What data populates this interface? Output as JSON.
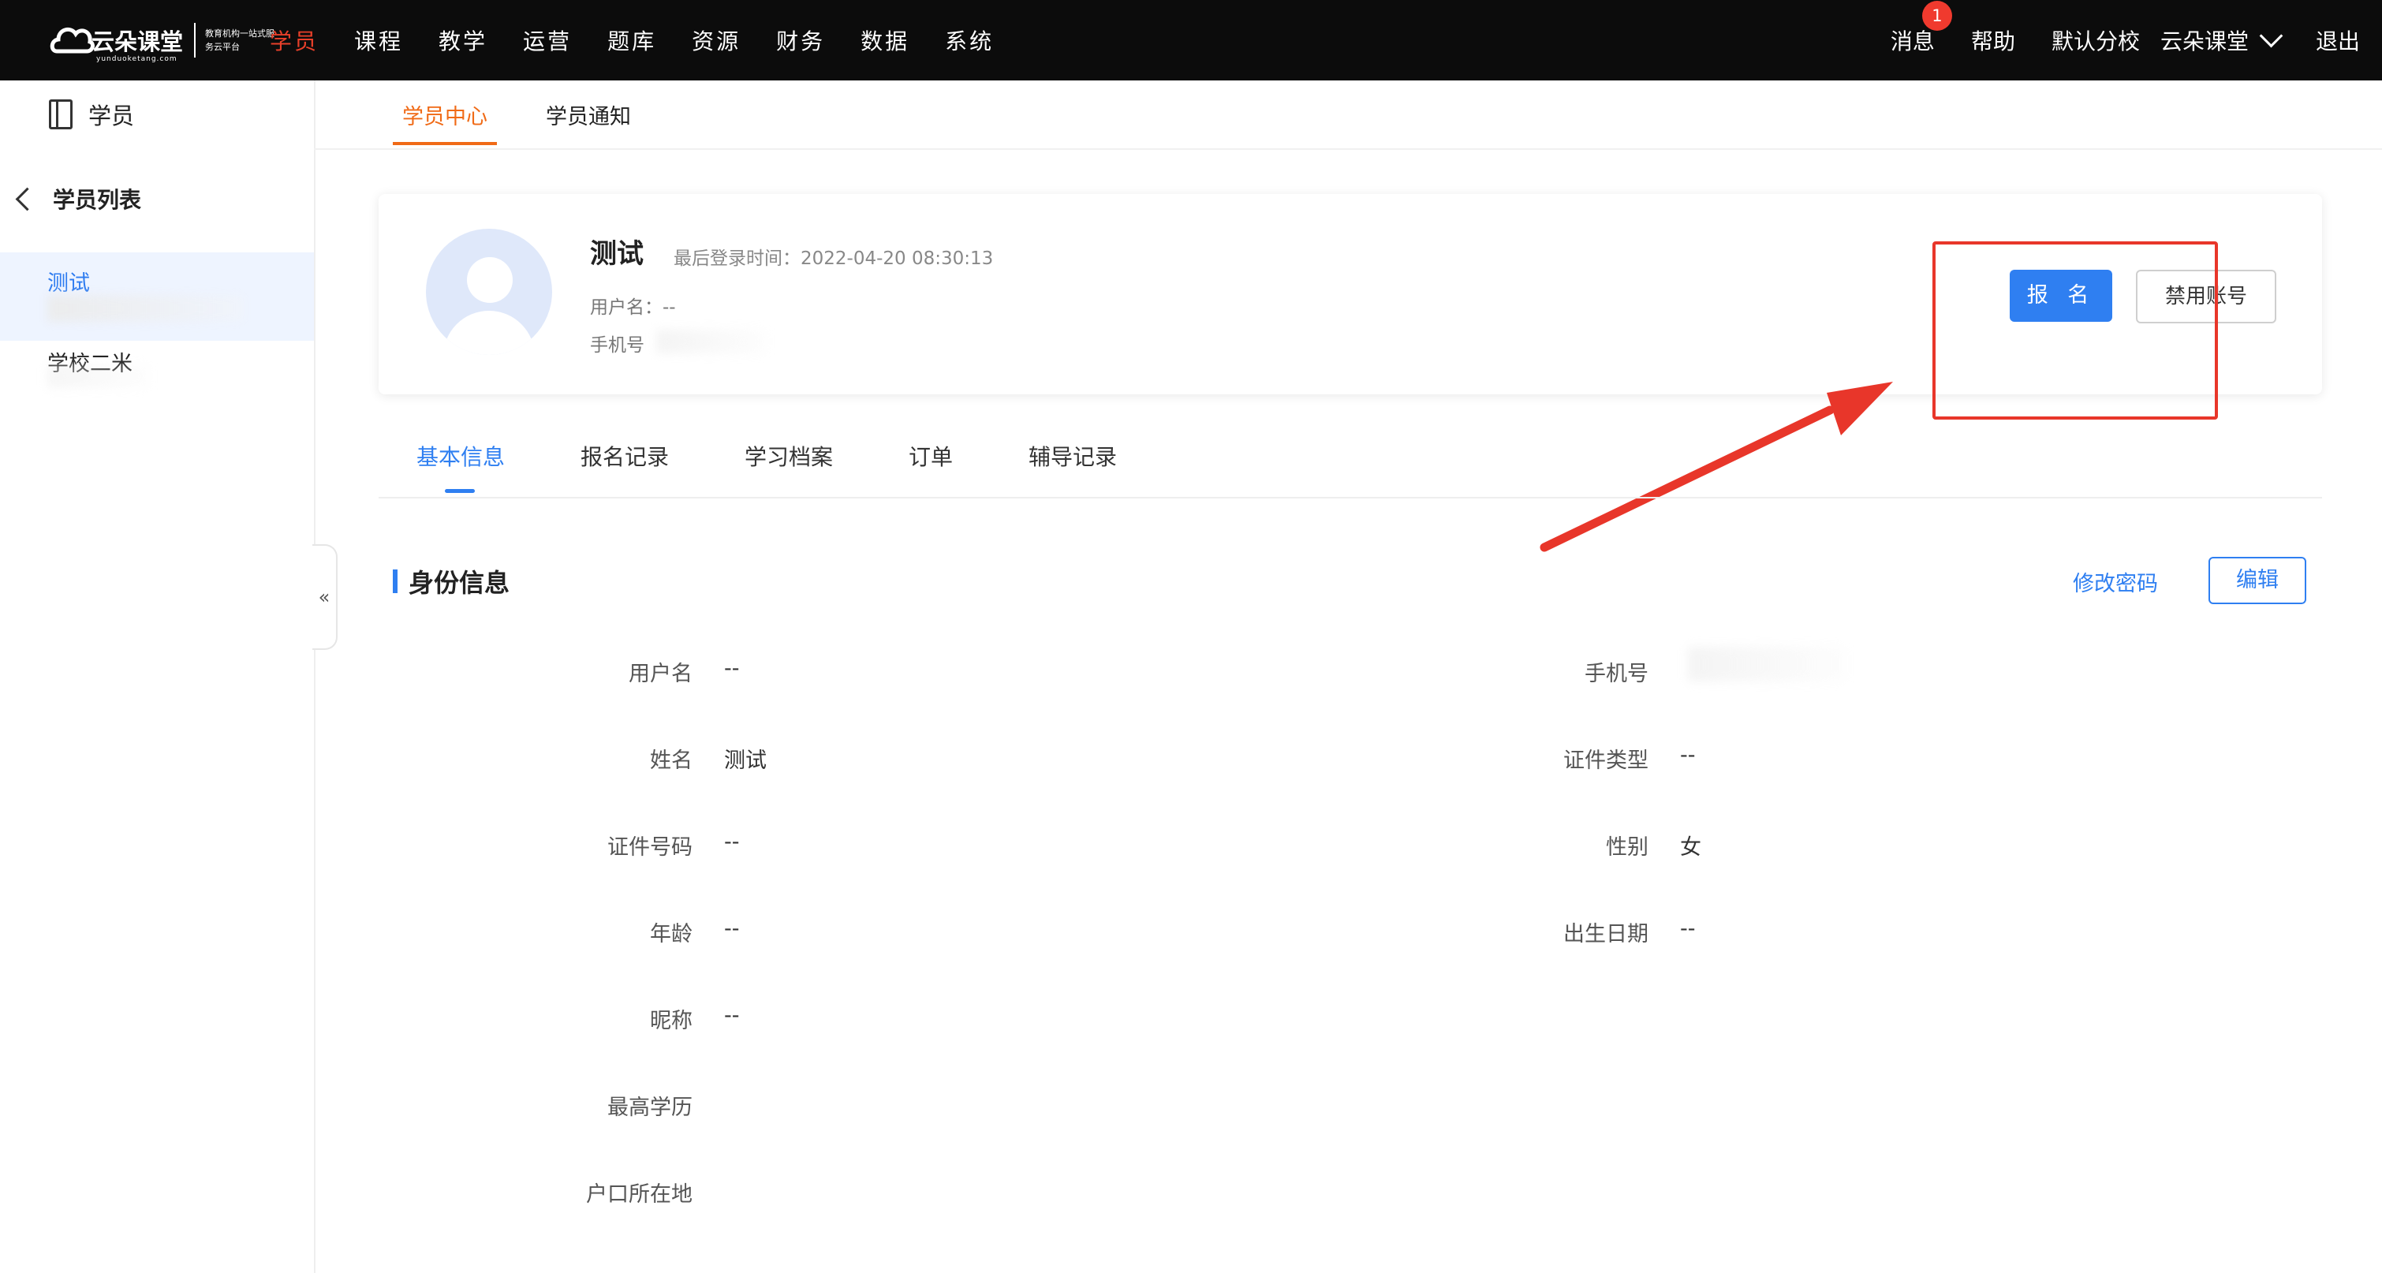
{
  "header": {
    "logo": {
      "name": "云朵课堂",
      "domain": "yunduoketang.com",
      "tagline": "教育机构一站式服务云平台"
    },
    "nav": [
      "学员",
      "课程",
      "教学",
      "运营",
      "题库",
      "资源",
      "财务",
      "数据",
      "系统"
    ],
    "active_nav": "学员",
    "right": {
      "messages": "消息",
      "message_count": "1",
      "help": "帮助",
      "school": "默认分校",
      "org": "云朵课堂",
      "logout": "退出"
    }
  },
  "sidebar": {
    "title": "学员",
    "back_label": "学员列表",
    "items": [
      "测试",
      "学校二米"
    ],
    "collapse_glyph": "«"
  },
  "subtabs": [
    "学员中心",
    "学员通知"
  ],
  "profile": {
    "name": "测试",
    "last_login_label": "最后登录时间：",
    "last_login": "2022-04-20 08:30:13",
    "username_line": "用户名：--",
    "phone_line": "手机号",
    "signup_button": "报 名",
    "disable_button": "禁用账号"
  },
  "detail_tabs": [
    "基本信息",
    "报名记录",
    "学习档案",
    "订单",
    "辅导记录"
  ],
  "identity": {
    "title": "身份信息",
    "change_password": "修改密码",
    "edit": "编辑",
    "fields": [
      {
        "label": "用户名",
        "value": "--"
      },
      {
        "label": "手机号",
        "value": ""
      },
      {
        "label": "姓名",
        "value": "测试"
      },
      {
        "label": "证件类型",
        "value": "--"
      },
      {
        "label": "证件号码",
        "value": "--"
      },
      {
        "label": "性别",
        "value": "女"
      },
      {
        "label": "年龄",
        "value": "--"
      },
      {
        "label": "出生日期",
        "value": "--"
      },
      {
        "label": "昵称",
        "value": "--"
      },
      {
        "label": "最高学历",
        "value": ""
      },
      {
        "label": "户口所在地",
        "value": ""
      }
    ]
  },
  "colors": {
    "brand_orange": "#f06a16",
    "primary_blue": "#2f7ff1",
    "nav_active": "#e8402a",
    "annotation_red": "#e8362a"
  }
}
